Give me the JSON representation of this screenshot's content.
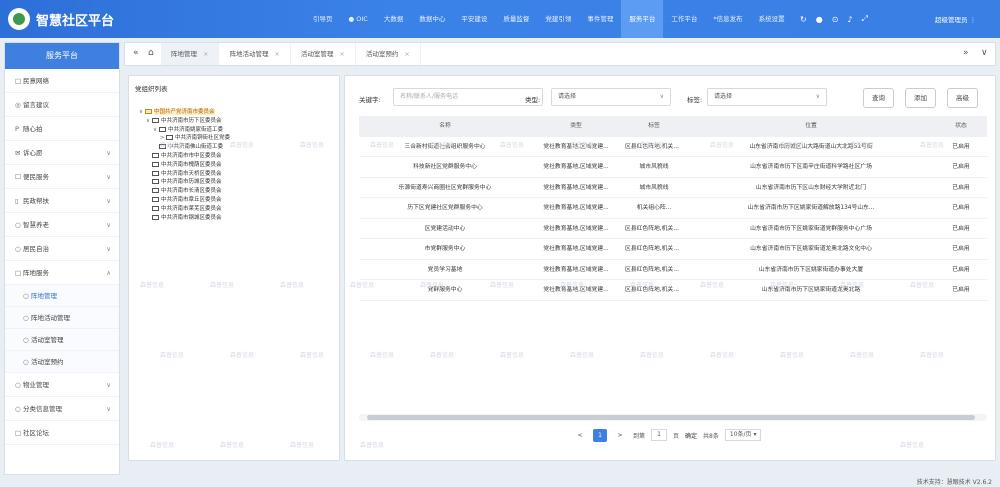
{
  "app": {
    "title": "智慧社区平台"
  },
  "topnav": [
    {
      "label": "引导页",
      "active": false
    },
    {
      "label": "● OIC",
      "active": false
    },
    {
      "label": "大数据",
      "active": false
    },
    {
      "label": "数据中心",
      "active": false
    },
    {
      "label": "平安建设",
      "active": false
    },
    {
      "label": "质量监督",
      "active": false
    },
    {
      "label": "党建引领",
      "active": false
    },
    {
      "label": "事件管理",
      "active": false
    },
    {
      "label": "服务平台",
      "active": true
    },
    {
      "label": "工作平台",
      "active": false
    },
    {
      "label": "*信息发布",
      "active": false
    },
    {
      "label": "系统设置",
      "active": false
    }
  ],
  "header": {
    "user": "超级管理员 ⋮"
  },
  "sidebar": {
    "title": "服务平台",
    "items": [
      {
        "label": "民意网络",
        "icon": "□"
      },
      {
        "label": "留言建议",
        "icon": "◎"
      },
      {
        "label": "随心拍",
        "icon": "P"
      },
      {
        "label": "诉心愿",
        "icon": "✉",
        "chev": "∨"
      },
      {
        "label": "便民服务",
        "icon": "☐",
        "chev": "∨"
      },
      {
        "label": "民政帮扶",
        "icon": "▯",
        "chev": "∨"
      },
      {
        "label": "智慧养老",
        "icon": "○",
        "chev": "∨"
      },
      {
        "label": "居民自治",
        "icon": "○",
        "chev": "∨"
      },
      {
        "label": "阵地服务",
        "icon": "□",
        "chev": "∧"
      }
    ],
    "subitems": [
      {
        "label": "阵地管理",
        "active": true
      },
      {
        "label": "阵地活动管理",
        "active": false
      },
      {
        "label": "活动室管理",
        "active": false
      },
      {
        "label": "活动室预约",
        "active": false
      }
    ],
    "items_after": [
      {
        "label": "物业管理",
        "icon": "○",
        "chev": "∨"
      },
      {
        "label": "分类信息管理",
        "icon": "○",
        "chev": "∨"
      },
      {
        "label": "社区论坛",
        "icon": "□"
      }
    ]
  },
  "tabs": {
    "prev": "«",
    "home": "⌂",
    "next": "»",
    "more": "∨",
    "items": [
      {
        "label": "阵地管理",
        "active": true
      },
      {
        "label": "阵地活动管理",
        "active": false
      },
      {
        "label": "活动室管理",
        "active": false
      },
      {
        "label": "活动室预约",
        "active": false
      }
    ]
  },
  "tree": {
    "title": "党组织列表",
    "nodes": [
      {
        "label": "中国共产党济南市委员会",
        "level": 0,
        "toggle": "∨",
        "selected": true
      },
      {
        "label": "中共济南市历下区委员会",
        "level": 1,
        "toggle": "∨",
        "selected": false
      },
      {
        "label": "中共济南姚家街道工委",
        "level": 2,
        "toggle": "∨",
        "selected": false
      },
      {
        "label": "中共济南铜街社区党委",
        "level": 3,
        "toggle": ">",
        "selected": false
      },
      {
        "label": "中共济南佛山街道工委",
        "level": 2,
        "toggle": "",
        "selected": false
      },
      {
        "label": "中共济南市市中区委员会",
        "level": 1,
        "toggle": "",
        "selected": false
      },
      {
        "label": "中共济南市槐荫区委员会",
        "level": 1,
        "toggle": "",
        "selected": false
      },
      {
        "label": "中共济南市天桥区委员会",
        "level": 1,
        "toggle": "",
        "selected": false
      },
      {
        "label": "中共济南市历城区委员会",
        "level": 1,
        "toggle": "",
        "selected": false
      },
      {
        "label": "中共济南市长清区委员会",
        "level": 1,
        "toggle": "",
        "selected": false
      },
      {
        "label": "中共济南市章丘区委员会",
        "level": 1,
        "toggle": "",
        "selected": false
      },
      {
        "label": "中共济南市莱芜区委员会",
        "level": 1,
        "toggle": "",
        "selected": false
      },
      {
        "label": "中共济南市钢城区委员会",
        "level": 1,
        "toggle": "",
        "selected": false
      }
    ]
  },
  "filters": {
    "keyword_label": "关键字:",
    "keyword_placeholder": "名称/联系人/服务电话",
    "type_label": "类型:",
    "type_value": "请选择",
    "tag_label": "标签:",
    "tag_value": "请选择",
    "query_btn": "查询",
    "add_btn": "添加",
    "advanced_btn": "高级"
  },
  "table": {
    "headers": [
      "名称",
      "类型",
      "标签",
      "位置",
      "状态"
    ],
    "rows": [
      [
        "三合新村街道社会组织服务中心",
        "党社教育基地,区域党建...",
        "区县红色阵地,机关组心阵...",
        "山东省济南市历城区山大路街道山大北路51号街",
        "已启用"
      ],
      [
        "科技新社区党群服务中心",
        "党社教育基地,区域党建...",
        "城市风貌线",
        "山东省济南市历下区南辛庄街道科学路社区广场",
        "已启用"
      ],
      [
        "乐源街道寿兴商圈社区党群服务中心",
        "党社教育基地,区域党建...",
        "城市风貌线",
        "山东省济南市历下区山东财经大学附近北门",
        "已启用"
      ],
      [
        "历下区党建社区党群服务中心",
        "党社教育基地,区域党建...",
        "机关组心阵...",
        "山东省济南市历下区姚家街道解放路134号山东...",
        "已启用"
      ],
      [
        "区党建活动中心",
        "党社教育基地,区域党建...",
        "区县红色阵地,机关组心阵...",
        "山东省济南市历下区姚家街道党群服务中心广场",
        "已启用"
      ],
      [
        "市党群服务中心",
        "党社教育基地,区域党建...",
        "区县红色阵地,机关组心阵...",
        "山东省济南市历下区姚家街道龙奥北路文化中心",
        "已启用"
      ],
      [
        "党员学习基地",
        "党社教育基地,区域党建...",
        "区县红色阵地,机关组心阵...",
        "山东省济南市历下区姚家街道办事处大厦",
        "已启用"
      ],
      [
        "党群服务中心",
        "党社教育基地,区域党建...",
        "区县红色阵地,机关组心阵...",
        "山东省济南市历下区姚家街道龙奥北路",
        "已启用"
      ]
    ]
  },
  "pager": {
    "prev": "<",
    "current": "1",
    "next": ">",
    "goto_label": "到第",
    "goto_value": "1",
    "page_unit": "页",
    "confirm": "确定",
    "total": "共8条",
    "page_size": "10条/页 ▾"
  },
  "footer": {
    "text": "技术支持：慧眼技术  V2.6.2"
  },
  "watermark": "森普信息"
}
